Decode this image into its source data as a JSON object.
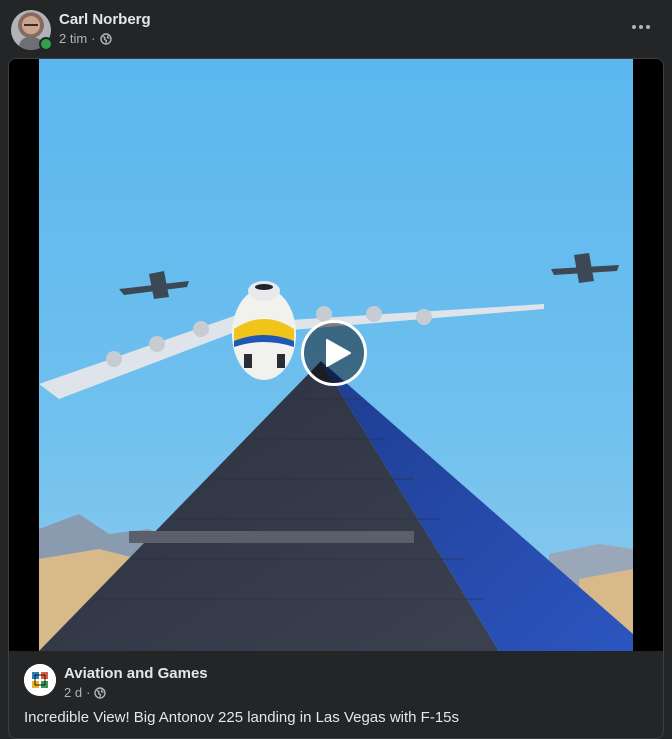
{
  "post": {
    "author": "Carl Norberg",
    "time": "2 tim",
    "separator": "·",
    "audience_icon": "globe-icon",
    "online": true
  },
  "shared": {
    "page_name": "Aviation and Games",
    "time": "2 d",
    "separator": "·",
    "audience_icon": "globe-icon",
    "caption": "Incredible View! Big Antonov 225 landing in Las Vegas with F-15s"
  },
  "colors": {
    "background": "#242526",
    "text_primary": "#e4e6eb",
    "text_secondary": "#b0b3b8",
    "online": "#31a24c",
    "sky": "#5aaee6"
  }
}
